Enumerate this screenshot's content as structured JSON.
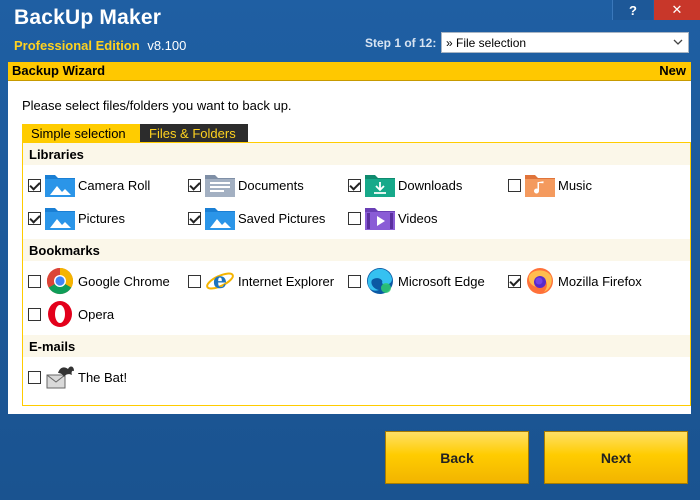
{
  "window": {
    "app_title": "BackUp Maker",
    "edition": "Professional Edition",
    "version": "v8.100",
    "help_label": "?",
    "close_label": "✕"
  },
  "step": {
    "label": "Step 1 of 12:",
    "selected": "» File selection"
  },
  "wizard": {
    "title": "Backup Wizard",
    "mode": "New"
  },
  "panel": {
    "instruction": "Please select files/folders you want to back up.",
    "tabs": [
      {
        "label": "Simple selection",
        "active": true
      },
      {
        "label": "Files & Folders",
        "active": false
      }
    ]
  },
  "libraries": {
    "title": "Libraries",
    "items": [
      {
        "label": "Camera Roll",
        "checked": true,
        "icon": "camera-roll-folder-icon"
      },
      {
        "label": "Documents",
        "checked": true,
        "icon": "documents-folder-icon"
      },
      {
        "label": "Downloads",
        "checked": true,
        "icon": "downloads-folder-icon"
      },
      {
        "label": "Music",
        "checked": false,
        "icon": "music-folder-icon"
      },
      {
        "label": "Pictures",
        "checked": true,
        "icon": "pictures-folder-icon"
      },
      {
        "label": "Saved Pictures",
        "checked": true,
        "icon": "saved-pictures-folder-icon"
      },
      {
        "label": "Videos",
        "checked": false,
        "icon": "videos-folder-icon"
      }
    ]
  },
  "bookmarks": {
    "title": "Bookmarks",
    "items": [
      {
        "label": "Google Chrome",
        "checked": false,
        "icon": "chrome-icon"
      },
      {
        "label": "Internet Explorer",
        "checked": false,
        "icon": "internet-explorer-icon"
      },
      {
        "label": "Microsoft Edge",
        "checked": false,
        "icon": "edge-icon"
      },
      {
        "label": "Mozilla Firefox",
        "checked": true,
        "icon": "firefox-icon"
      },
      {
        "label": "Opera",
        "checked": false,
        "icon": "opera-icon"
      }
    ]
  },
  "emails": {
    "title": "E-mails",
    "items": [
      {
        "label": "The Bat!",
        "checked": false,
        "icon": "the-bat-icon"
      }
    ]
  },
  "footer": {
    "back_label": "Back",
    "next_label": "Next"
  },
  "colors": {
    "window_blue": "#1a5390",
    "accent_yellow": "#ffcc00",
    "edition_yellow": "#ffd21f",
    "close_red": "#c8372a"
  }
}
